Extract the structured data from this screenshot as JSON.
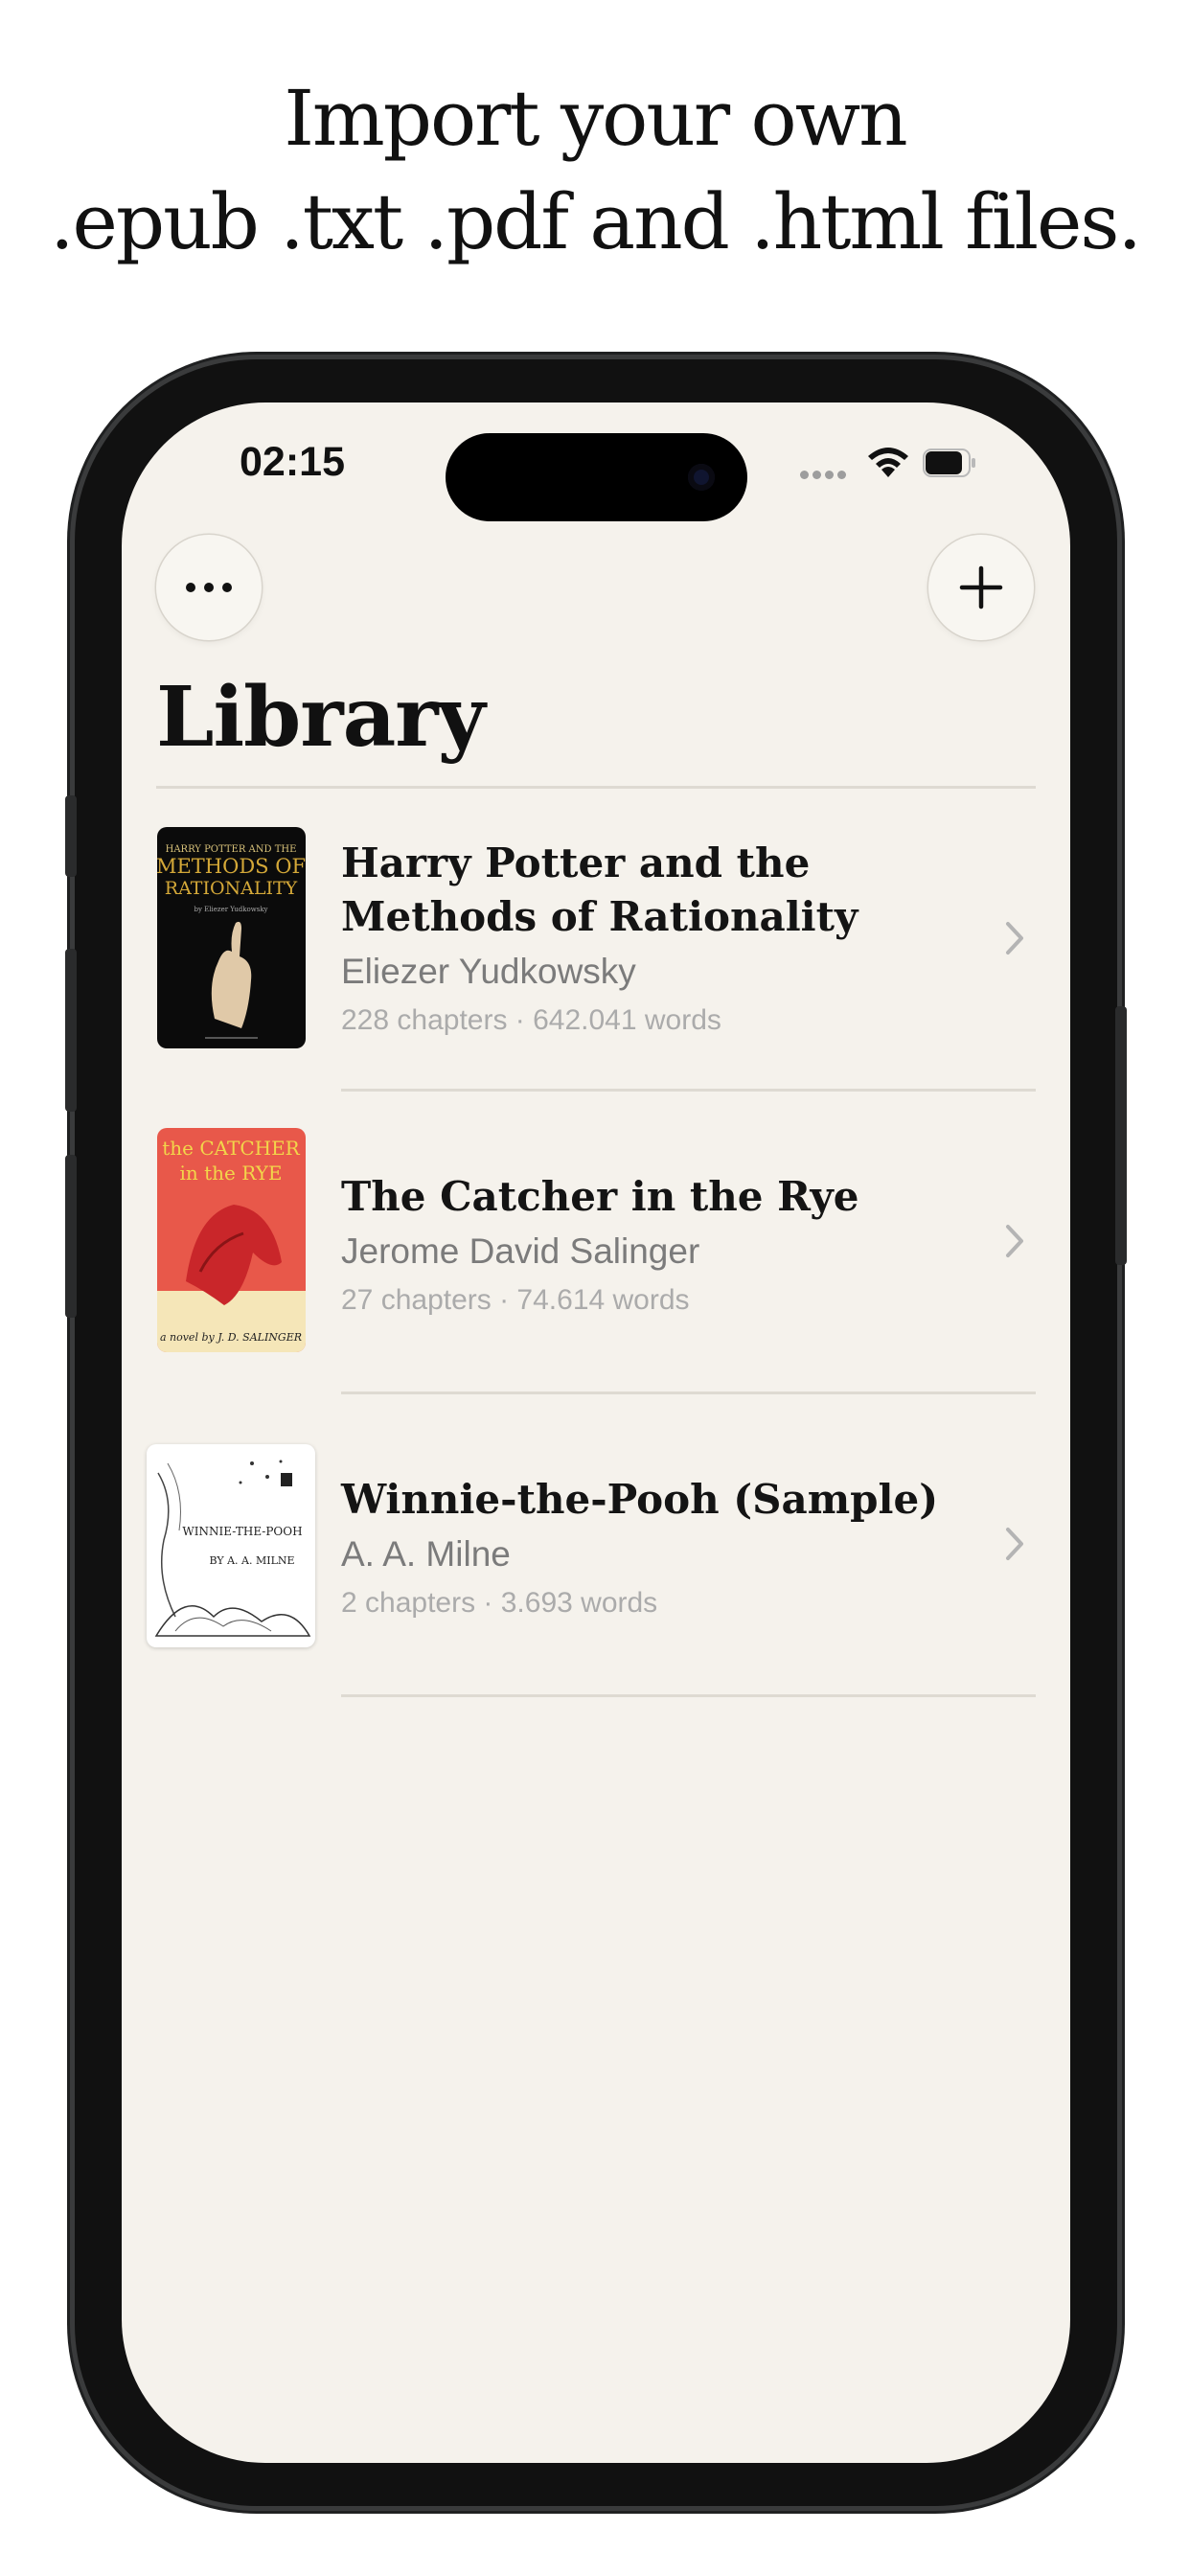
{
  "headline": {
    "line1": "Import your own",
    "line2": ".epub .txt .pdf and .html files."
  },
  "status_bar": {
    "time": "02:15"
  },
  "toolbar": {
    "more_icon": "ellipsis-icon",
    "add_icon": "plus-icon"
  },
  "library": {
    "title": "Library",
    "books": [
      {
        "title": "Harry Potter and the Methods of Rationality",
        "author": "Eliezer Yudkowsky",
        "meta": "228 chapters · 642.041 words",
        "cover_text": [
          "HARRY POTTER AND THE",
          "METHODS OF",
          "RATIONALITY",
          "by Eliezer Yudkowsky"
        ]
      },
      {
        "title": "The Catcher in the Rye",
        "author": "Jerome David Salinger",
        "meta": "27 chapters · 74.614 words",
        "cover_text": [
          "the CATCHER",
          "in the RYE",
          "a novel by J. D. SALINGER"
        ]
      },
      {
        "title": "Winnie-the-Pooh (Sample)",
        "author": "A. A. Milne",
        "meta": "2 chapters · 3.693 words",
        "cover_text": [
          "WINNIE-THE-POOH",
          "BY A. A. MILNE"
        ]
      }
    ]
  },
  "colors": {
    "screen_bg": "#f5f2ec",
    "separator": "#dedad2",
    "author_text": "#7b7b7b",
    "meta_text": "#ababab"
  }
}
